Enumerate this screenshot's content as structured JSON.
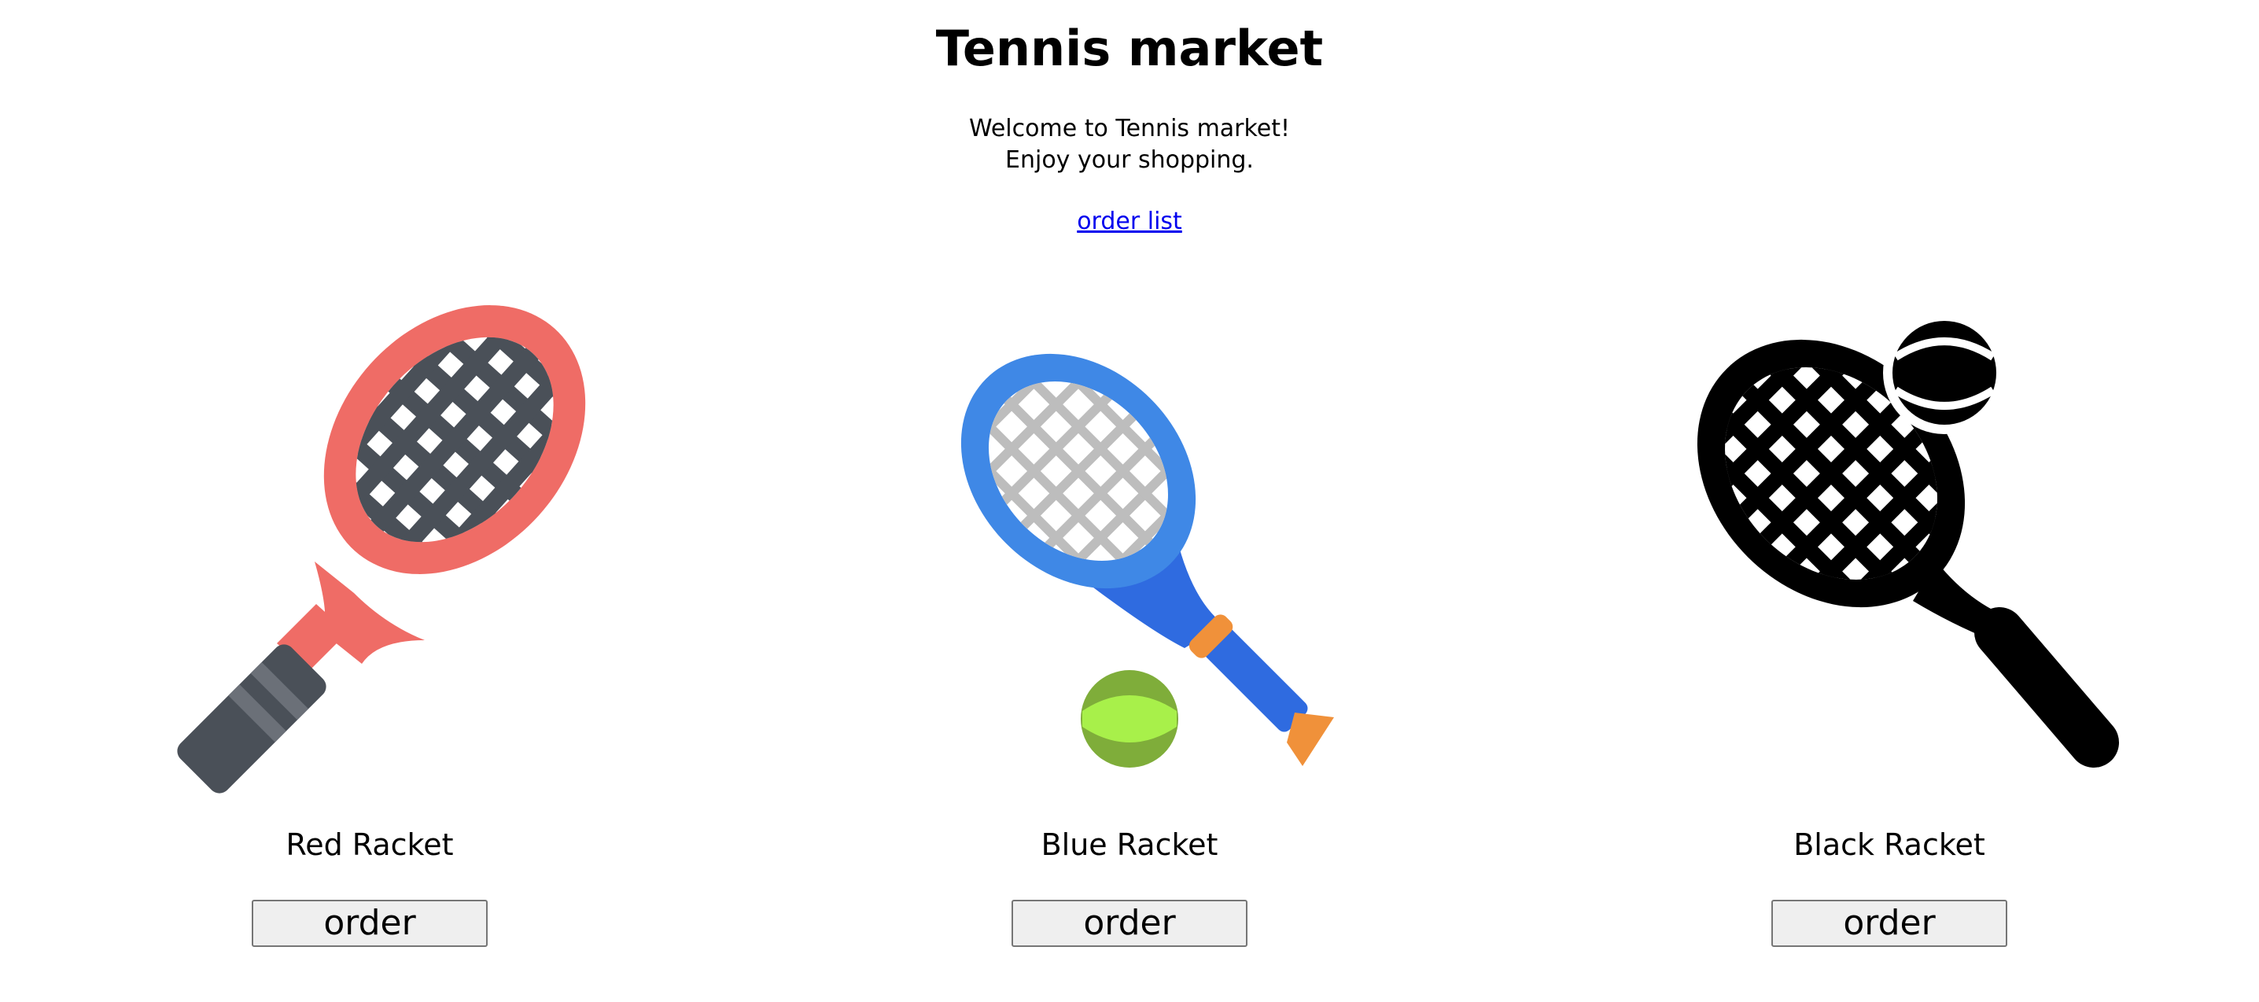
{
  "page": {
    "title": "Tennis market",
    "welcome_line_1": "Welcome to Tennis market!",
    "welcome_line_2": "Enjoy your shopping.",
    "order_list_label": "order list"
  },
  "products": [
    {
      "name": "Red Racket",
      "order_label": "order",
      "icon": "red-tennis-racket-icon",
      "colors": {
        "frame": "#ef6c66",
        "strings": "#4a5058",
        "grip": "#4a5058",
        "grip_stripe": "#6b7078"
      }
    },
    {
      "name": "Blue Racket",
      "order_label": "order",
      "icon": "blue-tennis-racket-and-ball-icon",
      "colors": {
        "frame": "#3f88e6",
        "throat": "#2f6be0",
        "strings": "#bdbdbd",
        "collar": "#f0913a",
        "ball": "#a8f04a",
        "ball_shadow": "#7fad3a"
      }
    },
    {
      "name": "Black Racket",
      "order_label": "order",
      "icon": "black-tennis-racket-and-ball-icon",
      "colors": {
        "frame": "#000000"
      }
    }
  ]
}
